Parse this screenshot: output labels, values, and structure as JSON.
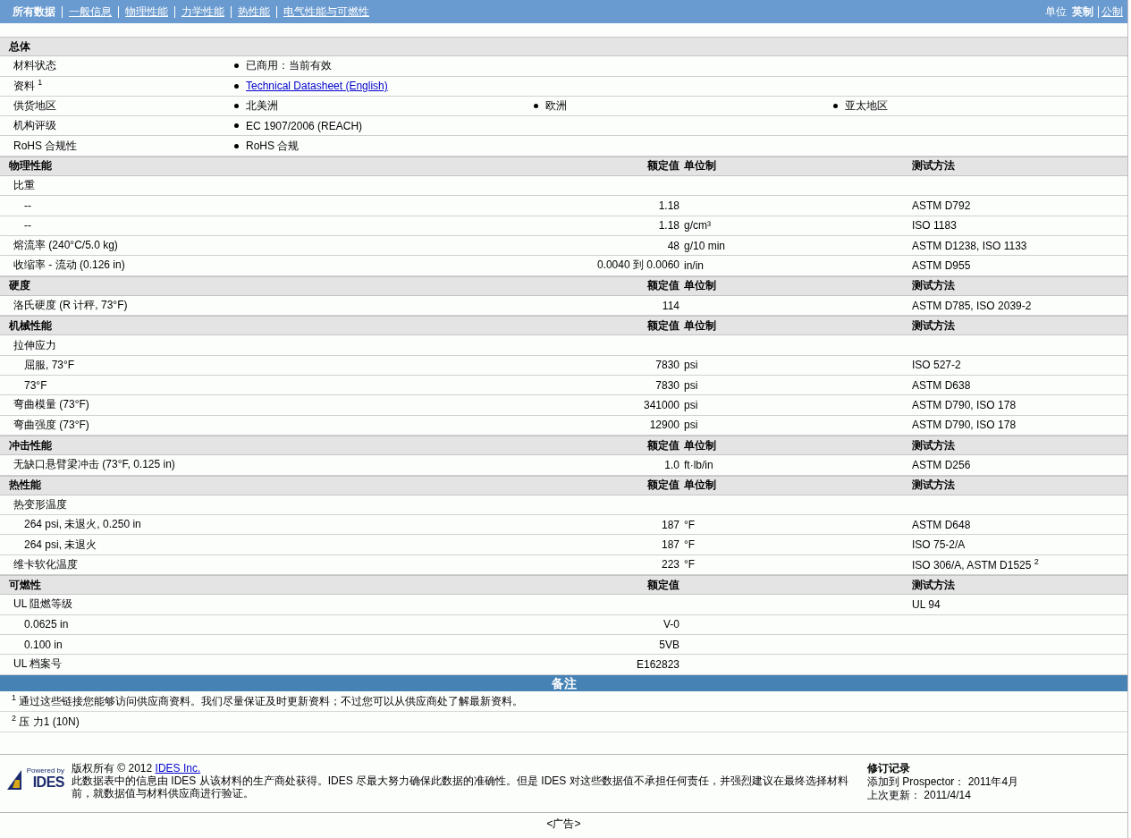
{
  "nav": {
    "tabs": [
      {
        "label": "所有数据",
        "selected": true
      },
      {
        "label": "一般信息",
        "selected": false
      },
      {
        "label": "物理性能",
        "selected": false
      },
      {
        "label": "力学性能",
        "selected": false
      },
      {
        "label": "热性能",
        "selected": false
      },
      {
        "label": "电气性能与可燃性",
        "selected": false
      }
    ],
    "units_label": "单位",
    "units": [
      {
        "label": "英制",
        "selected": true
      },
      {
        "label": "公制",
        "selected": false
      }
    ]
  },
  "sections": [
    {
      "title": "总体",
      "kind": "general",
      "rows": [
        {
          "label": "材料状态",
          "items": [
            {
              "text": "已商用：当前有效",
              "kind": "text"
            }
          ]
        },
        {
          "label": "资料",
          "sup": "1",
          "items": [
            {
              "text": "Technical Datasheet (English)",
              "kind": "link"
            }
          ]
        },
        {
          "label": "供货地区",
          "items": [
            {
              "text": "北美洲",
              "kind": "text"
            },
            {
              "text": "欧洲",
              "kind": "text"
            },
            {
              "text": "亚太地区",
              "kind": "text"
            }
          ]
        },
        {
          "label": "机构评级",
          "items": [
            {
              "text": "EC 1907/2006 (REACH)",
              "kind": "text"
            }
          ]
        },
        {
          "label": "RoHS 合规性",
          "items": [
            {
              "text": "RoHS 合规",
              "kind": "text"
            }
          ]
        }
      ]
    },
    {
      "title": "物理性能",
      "kind": "data",
      "headers": {
        "value": "额定值",
        "unit": "单位制",
        "method": "测试方法"
      },
      "rows": [
        {
          "label": "比重",
          "children": [
            {
              "label": "--",
              "value": "1.18",
              "method": "ASTM D792"
            },
            {
              "label": "--",
              "value": "1.18",
              "unit": "g/cm³",
              "method": "ISO 1183"
            }
          ]
        },
        {
          "label": "熔流率  (240°C/5.0 kg)",
          "value": "48",
          "unit": "g/10 min",
          "method": "ASTM D1238, ISO 1133"
        },
        {
          "label": "收缩率  - 流动  (0.126 in)",
          "value": "0.0040 到  0.0060",
          "unit": "in/in",
          "method": "ASTM D955"
        }
      ]
    },
    {
      "title": "硬度",
      "kind": "data",
      "headers": {
        "value": "额定值",
        "unit": "单位制",
        "method": "测试方法"
      },
      "rows": [
        {
          "label": "洛氏硬度  (R 计秤, 73°F)",
          "value": "114",
          "method": "ASTM D785, ISO 2039-2"
        }
      ]
    },
    {
      "title": "机械性能",
      "kind": "data",
      "headers": {
        "value": "额定值",
        "unit": "单位制",
        "method": "测试方法"
      },
      "rows": [
        {
          "label": "拉伸应力",
          "children": [
            {
              "label": "屈服, 73°F",
              "value": "7830",
              "unit": "psi",
              "method": "ISO 527-2"
            },
            {
              "label": "73°F",
              "value": "7830",
              "unit": "psi",
              "method": "ASTM D638"
            }
          ]
        },
        {
          "label": "弯曲模量  (73°F)",
          "value": "341000",
          "unit": "psi",
          "method": "ASTM D790, ISO 178"
        },
        {
          "label": "弯曲强度  (73°F)",
          "value": "12900",
          "unit": "psi",
          "method": "ASTM D790, ISO 178"
        }
      ]
    },
    {
      "title": "冲击性能",
      "kind": "data",
      "headers": {
        "value": "额定值",
        "unit": "单位制",
        "method": "测试方法"
      },
      "rows": [
        {
          "label": "无缺口悬臂梁冲击  (73°F, 0.125 in)",
          "value": "1.0",
          "unit": "ft·lb/in",
          "method": "ASTM D256"
        }
      ]
    },
    {
      "title": "热性能",
      "kind": "data",
      "headers": {
        "value": "额定值",
        "unit": "单位制",
        "method": "测试方法"
      },
      "rows": [
        {
          "label": "热变形温度",
          "children": [
            {
              "label": "264 psi, 未退火, 0.250 in",
              "value": "187",
              "unit": "°F",
              "method": "ASTM D648"
            },
            {
              "label": "264 psi, 未退火",
              "value": "187",
              "unit": "°F",
              "method": "ISO 75-2/A"
            }
          ]
        },
        {
          "label": "维卡软化温度",
          "value": "223",
          "unit": "°F",
          "method": "ISO 306/A, ASTM D1525",
          "method_sup": "2"
        }
      ]
    },
    {
      "title": "可燃性",
      "kind": "data",
      "headers": {
        "value": "额定值",
        "method": "测试方法"
      },
      "rows": [
        {
          "label": "UL 阻燃等级",
          "method": "UL 94",
          "children": [
            {
              "label": "0.0625 in",
              "value": "V-0"
            },
            {
              "label": "0.100 in",
              "value": "5VB"
            }
          ]
        },
        {
          "label": "UL 档案号",
          "value": "E162823"
        }
      ]
    }
  ],
  "notes": {
    "title": "备注",
    "items": [
      {
        "sup": "1",
        "text": "通过这些链接您能够访问供应商资料。我们尽量保证及时更新资料；不过您可以从供应商处了解最新资料。"
      },
      {
        "sup": "2",
        "text": "压  力1 (10N)"
      }
    ]
  },
  "footer": {
    "logo_top": "Powered by",
    "logo_name": "IDES",
    "copyright": "版权所有  © 2012",
    "copyright_link": "IDES Inc.",
    "disclaimer": "此数据表中的信息由  IDES 从该材料的生产商处获得。IDES 尽最大努力确保此数据的准确性。但是  IDES 对这些数据值不承担任何责任，并强烈建议在最终选择材料前，就数据值与材料供应商进行验证。",
    "revision_title": "修订记录",
    "revision_lines": [
      "添加到  Prospector：  2011年4月",
      "上次更新：  2011/4/14"
    ]
  },
  "ad": "<广告>"
}
